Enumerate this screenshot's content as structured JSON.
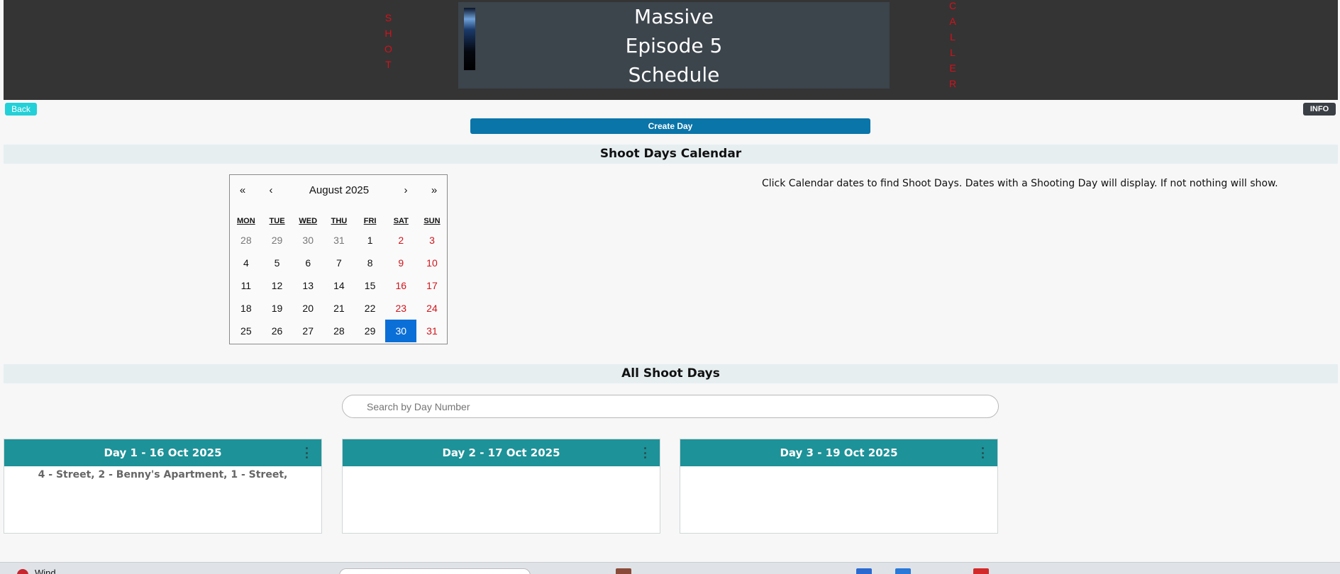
{
  "header": {
    "left_vertical": [
      "S",
      "H",
      "O",
      "T"
    ],
    "right_vertical": [
      "C",
      "A",
      "L",
      "L",
      "E",
      "R"
    ],
    "title_lines": [
      "Massive",
      "Episode 5",
      "Schedule"
    ]
  },
  "buttons": {
    "back": "Back",
    "info": "INFO",
    "create_day": "Create Day"
  },
  "calendar_section": {
    "title": "Shoot Days Calendar",
    "help_text": "Click Calendar dates to find Shoot Days. Dates with a Shooting Day will display. If not nothing will show.",
    "nav": {
      "prev_year": "«",
      "prev_month": "‹",
      "month_label": "August 2025",
      "next_month": "›",
      "next_year": "»"
    },
    "weekdays": [
      "MON",
      "TUE",
      "WED",
      "THU",
      "FRI",
      "SAT",
      "SUN"
    ],
    "weeks": [
      [
        "28",
        "29",
        "30",
        "31",
        "1",
        "2",
        "3"
      ],
      [
        "4",
        "5",
        "6",
        "7",
        "8",
        "9",
        "10"
      ],
      [
        "11",
        "12",
        "13",
        "14",
        "15",
        "16",
        "17"
      ],
      [
        "18",
        "19",
        "20",
        "21",
        "22",
        "23",
        "24"
      ],
      [
        "25",
        "26",
        "27",
        "28",
        "29",
        "30",
        "31"
      ]
    ],
    "selected_date": "30",
    "colors": {
      "weekend": "#d1141b",
      "selected": "#0b6fd8"
    }
  },
  "all_days_section": {
    "title": "All Shoot Days",
    "search_placeholder": "Search by Day Number"
  },
  "shoot_days": [
    {
      "title": "Day 1 - 16 Oct 2025",
      "scenes": "4 - Street, 2 - Benny's Apartment, 1 - Street,"
    },
    {
      "title": "Day 2 - 17 Oct 2025",
      "scenes": ""
    },
    {
      "title": "Day 3 - 19 Oct 2025",
      "scenes": ""
    }
  ],
  "taskbar": {
    "label": "Wind"
  }
}
